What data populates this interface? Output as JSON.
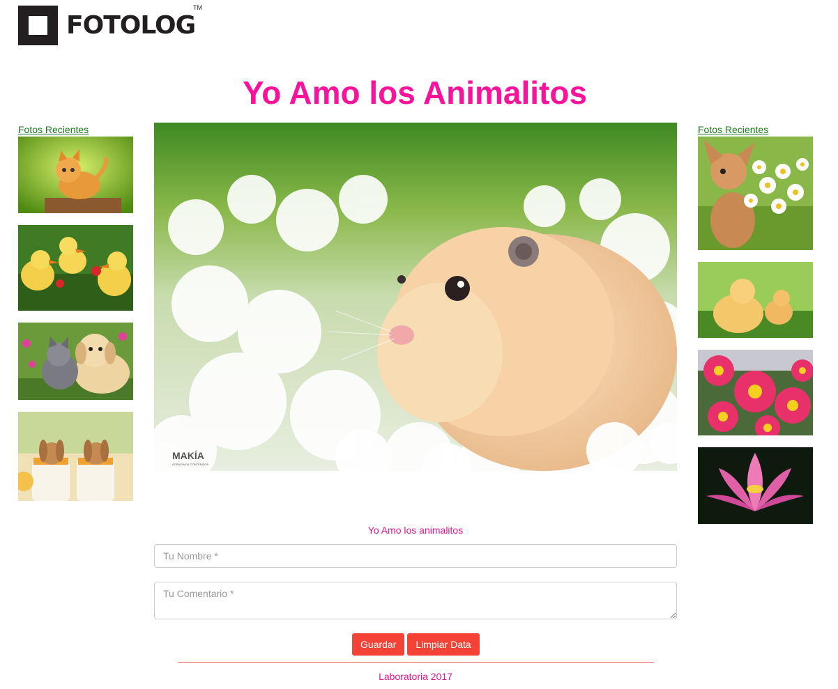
{
  "brand": {
    "name": "FOTOLOG",
    "trademark": "TM"
  },
  "page_title": "Yo Amo los Animalitos",
  "sidebar_left": {
    "link_label": "Fotos Recientes",
    "photos": [
      "kitten-photo",
      "ducklings-photo",
      "kitten-puppy-photo",
      "bunnies-photo"
    ]
  },
  "sidebar_right": {
    "link_label": "Fotos Recientes",
    "photos": [
      "chihuahua-daisies-photo",
      "chicks-photo",
      "pink-daisies-photo",
      "lotus-photo"
    ]
  },
  "main_photo": {
    "subject": "hamster-in-flowers-photo",
    "watermark": "MAKÍA",
    "watermark_sub": "AGENCIA DE CONTENIDOS"
  },
  "form": {
    "caption": "Yo Amo los animalitos",
    "name_placeholder": "Tu Nombre *",
    "comment_placeholder": "Tu Comentario *",
    "save_label": "Guardar",
    "clear_label": "Limpiar Data"
  },
  "footer": {
    "text": "Laboratoria 2017"
  },
  "colors": {
    "title": "#f7139b",
    "button": "#f44336",
    "link": "#1e7a1e",
    "divider": "#e05a54"
  }
}
